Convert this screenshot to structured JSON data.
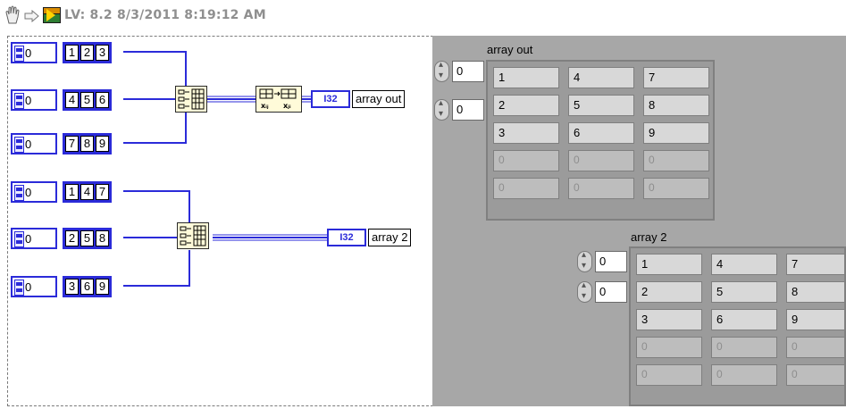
{
  "toolbar": {
    "title": "LV: 8.2 8/3/2011 8:19:12 AM",
    "hand_icon": "hand-icon",
    "arrow_icon": "arrow-icon",
    "lv_icon": "labview-icon"
  },
  "diagram": {
    "constants_group1": [
      {
        "index": "0",
        "values": [
          "1",
          "2",
          "3"
        ]
      },
      {
        "index": "0",
        "values": [
          "4",
          "5",
          "6"
        ]
      },
      {
        "index": "0",
        "values": [
          "7",
          "8",
          "9"
        ]
      }
    ],
    "constants_group2": [
      {
        "index": "0",
        "values": [
          "1",
          "4",
          "7"
        ]
      },
      {
        "index": "0",
        "values": [
          "2",
          "5",
          "8"
        ]
      },
      {
        "index": "0",
        "values": [
          "3",
          "6",
          "9"
        ]
      }
    ],
    "indicator1": {
      "type": "I32",
      "label": "array out"
    },
    "indicator2": {
      "type": "I32",
      "label": "array 2"
    },
    "colors": {
      "wire": "#2b2bd9",
      "node_fill": "#fffbd9",
      "panel": "#a7a7a7"
    }
  },
  "front_panel": {
    "array_out": {
      "label": "array out",
      "row_index": "0",
      "col_index": "0",
      "rows": [
        [
          "1",
          "4",
          "7"
        ],
        [
          "2",
          "5",
          "8"
        ],
        [
          "3",
          "6",
          "9"
        ],
        [
          "0",
          "0",
          "0"
        ],
        [
          "0",
          "0",
          "0"
        ]
      ]
    },
    "array_2": {
      "label": "array 2",
      "row_index": "0",
      "col_index": "0",
      "rows": [
        [
          "1",
          "4",
          "7"
        ],
        [
          "2",
          "5",
          "8"
        ],
        [
          "3",
          "6",
          "9"
        ],
        [
          "0",
          "0",
          "0"
        ],
        [
          "0",
          "0",
          "0"
        ]
      ]
    }
  }
}
